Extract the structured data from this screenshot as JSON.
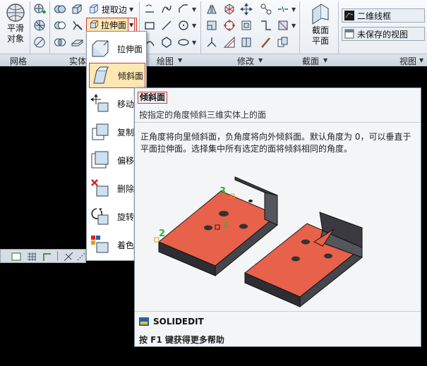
{
  "ribbon": {
    "smooth_object_label": "平滑\n对象",
    "extract_edges_label": "提取边",
    "extrude_faces_label": "拉伸面",
    "section_plane_label": "截面\n平面",
    "visual_style": "二维线框",
    "view_name": "未保存的视图",
    "panels": [
      "网格",
      "实体",
      "绘图",
      "修改",
      "截面",
      "视图"
    ]
  },
  "menu": {
    "items": [
      {
        "label": "拉伸面",
        "icon": "extrude-face-icon",
        "selected": false
      },
      {
        "label": "倾斜面",
        "icon": "taper-face-icon",
        "selected": true
      },
      {
        "label": "移动",
        "icon": "move-face-icon",
        "selected": false
      },
      {
        "label": "复制",
        "icon": "copy-face-icon",
        "selected": false
      },
      {
        "label": "偏移",
        "icon": "offset-face-icon",
        "selected": false
      },
      {
        "label": "删除",
        "icon": "delete-face-icon",
        "selected": false
      },
      {
        "label": "旋转",
        "icon": "rotate-face-icon",
        "selected": false
      },
      {
        "label": "着色",
        "icon": "color-face-icon",
        "selected": false
      }
    ]
  },
  "tooltip": {
    "title": "倾斜面",
    "subtitle": "按指定的角度倾斜三维实体上的面",
    "body": "正角度将向里倾斜面，负角度将向外倾斜面。默认角度为 0，可以垂直于平面拉伸面。选择集中所有选定的面将倾斜相同的角度。",
    "callouts": [
      "1",
      "2",
      "3"
    ],
    "command": "SOLIDEDIT",
    "help": "按 F1 键获得更多帮助"
  },
  "colors": {
    "accent_face": "#e8614a",
    "selection_border": "#cf3a3a",
    "callout_green": "#3fb03f"
  }
}
